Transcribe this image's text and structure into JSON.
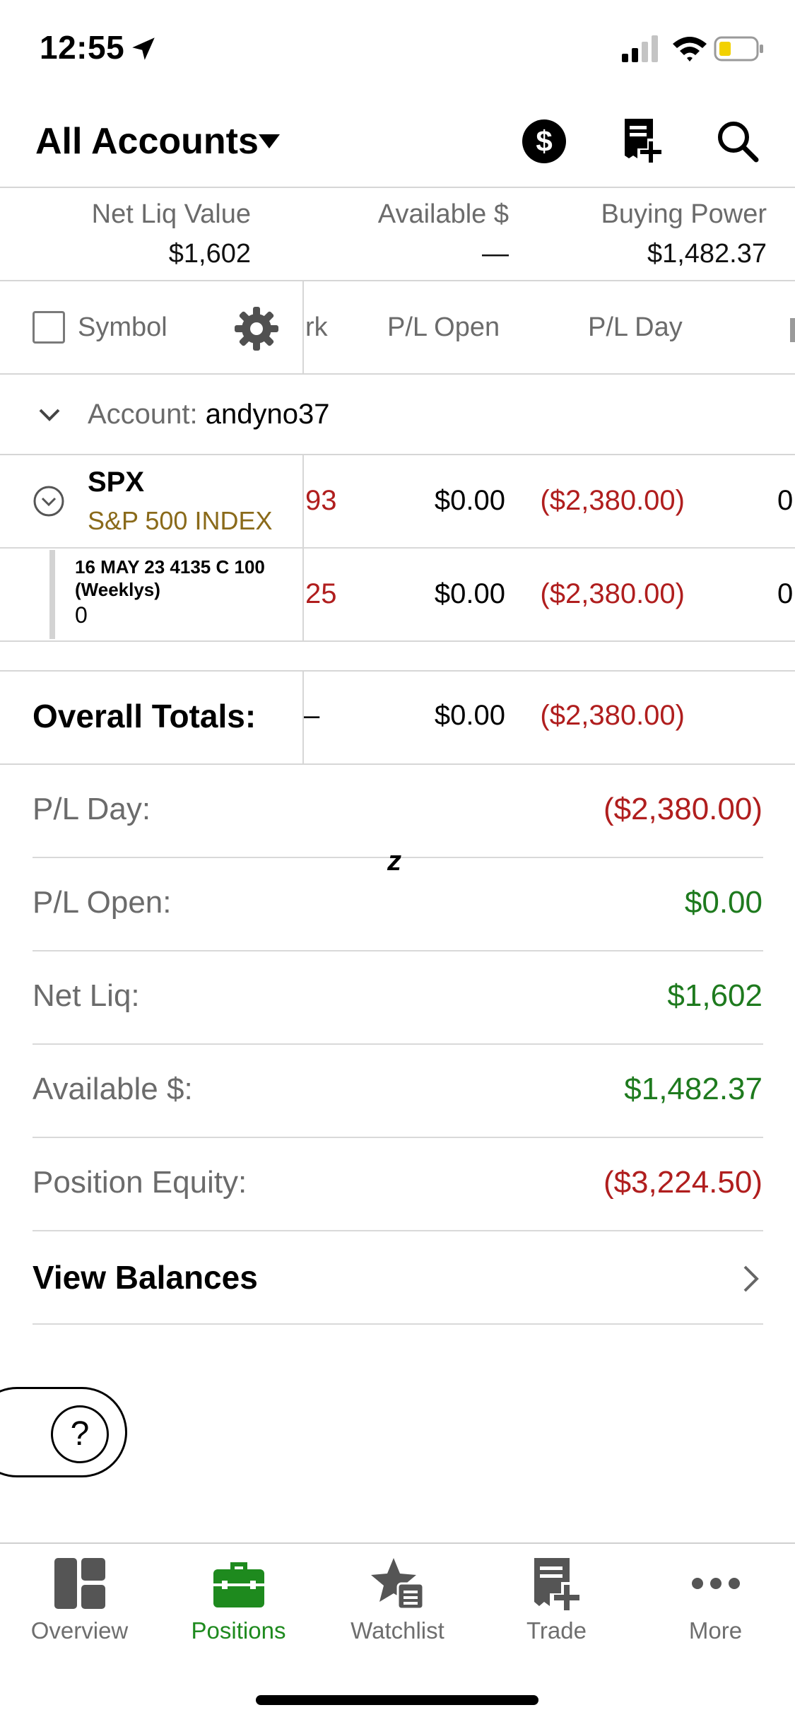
{
  "status_bar": {
    "time": "12:55"
  },
  "header": {
    "account_title": "All Accounts"
  },
  "summary": {
    "net_liq_label": "Net Liq Value",
    "net_liq_value": "$1,602",
    "available_label": "Available $",
    "available_value": "—",
    "buying_power_label": "Buying Power",
    "buying_power_value": "$1,482.37"
  },
  "columns": {
    "symbol": "Symbol",
    "mark_partial": "rk",
    "pl_open": "P/L Open",
    "pl_day": "P/L Day"
  },
  "account_group": {
    "label": "Account:",
    "name": "andyno37"
  },
  "positions": [
    {
      "symbol": "SPX",
      "description": "S&P 500 INDEX",
      "mark_partial": "93",
      "pl_open": "$0.00",
      "pl_day": "($2,380.00)",
      "extra_partial": "0"
    },
    {
      "symbol_line1": "16 MAY 23 4135 C 100",
      "symbol_line2": "(Weeklys)",
      "qty": "0",
      "mark_partial": "25",
      "pl_open": "$0.00",
      "pl_day": "($2,380.00)",
      "extra_partial": "0"
    }
  ],
  "totals": {
    "label": "Overall Totals:",
    "mark": "–",
    "pl_open": "$0.00",
    "pl_day": "($2,380.00)"
  },
  "details": [
    {
      "label": "P/L Day:",
      "value": "($2,380.00)",
      "color": "#b01e1e"
    },
    {
      "label": "P/L Open:",
      "value": "$0.00",
      "color": "#1e7a1e"
    },
    {
      "label": "Net Liq:",
      "value": "$1,602",
      "color": "#1e7a1e"
    },
    {
      "label": "Available $:",
      "value": "$1,482.37",
      "color": "#1e7a1e"
    },
    {
      "label": "Position Equity:",
      "value": "($3,224.50)",
      "color": "#b01e1e"
    }
  ],
  "view_balances": "View Balances",
  "stray_glyph": "z",
  "help": "?",
  "tabs": [
    {
      "label": "Overview",
      "icon": "overview-icon"
    },
    {
      "label": "Positions",
      "icon": "briefcase-icon",
      "active": true
    },
    {
      "label": "Watchlist",
      "icon": "watchlist-star-icon"
    },
    {
      "label": "Trade",
      "icon": "trade-ticket-icon"
    },
    {
      "label": "More",
      "icon": "more-dots-icon"
    }
  ],
  "colors": {
    "loss": "#b01e1e",
    "gain": "#1e7a1e",
    "active_tab": "#1e8a1e",
    "description": "#8a6a1a"
  }
}
